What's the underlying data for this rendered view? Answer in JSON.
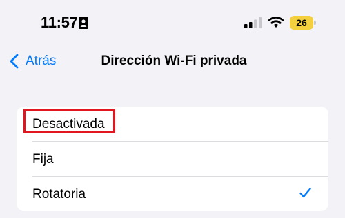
{
  "status_bar": {
    "time": "11:57",
    "battery_level": "26",
    "battery_color": "#f4d03f",
    "icons": [
      "contact-card-icon",
      "cellular-signal-icon",
      "wifi-icon",
      "battery-icon"
    ]
  },
  "nav": {
    "back_label": "Atrás",
    "title": "Dirección Wi-Fi privada",
    "accent_color": "#007aff"
  },
  "options": [
    {
      "label": "Desactivada",
      "selected": false,
      "highlighted": true
    },
    {
      "label": "Fija",
      "selected": false
    },
    {
      "label": "Rotatoria",
      "selected": true
    }
  ],
  "highlight_color": "#e0171f"
}
